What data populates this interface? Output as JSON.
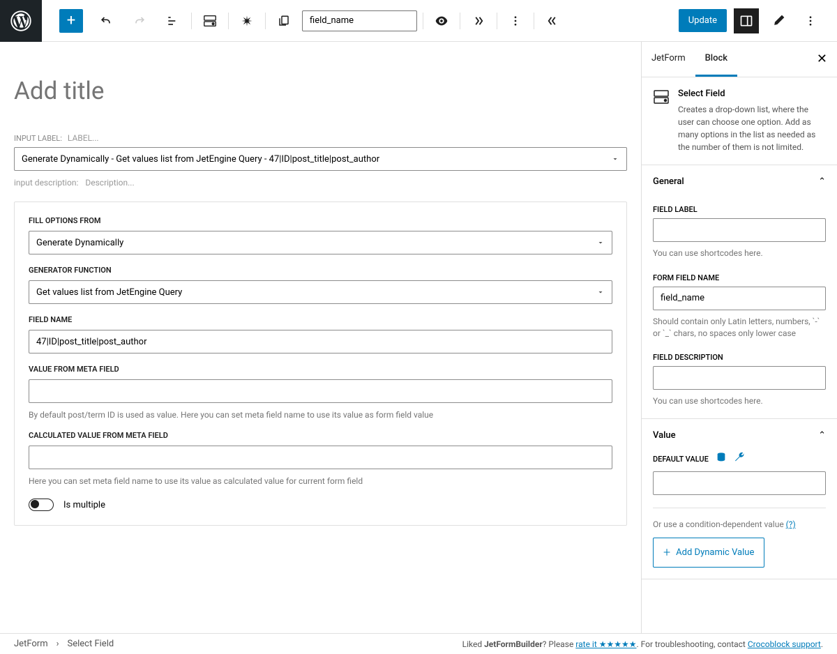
{
  "toolbar": {
    "field_name_value": "field_name",
    "update_label": "Update"
  },
  "editor": {
    "title_placeholder": "Add title",
    "input_label_prefix": "INPUT LABEL:",
    "input_label_placeholder": "LABEL...",
    "select_display": "Generate Dynamically - Get values list from JetEngine Query - 47|ID|post_title|post_author",
    "desc_prefix": "input description:",
    "desc_placeholder": "Description..."
  },
  "options": {
    "fill_label": "Fill Options From",
    "fill_value": "Generate Dynamically",
    "gen_func_label": "Generator Function",
    "gen_func_value": "Get values list from JetEngine Query",
    "field_name_label": "Field Name",
    "field_name_value": "47|ID|post_title|post_author",
    "value_meta_label": "Value from meta field",
    "value_meta_help": "By default post/term ID is used as value. Here you can set meta field name to use its value as form field value",
    "calc_label": "Calculated value from meta field",
    "calc_help": "Here you can set meta field name to use its value as calculated value for current form field",
    "is_multiple": "Is multiple"
  },
  "sidebar": {
    "tabs": {
      "jetform": "JetForm",
      "block": "Block"
    },
    "block_title": "Select Field",
    "block_desc": "Creates a drop-down list, where the user can choose one option. Add as many options in the list as needed as the number of them is not limited.",
    "general": {
      "title": "General",
      "field_label": "Field Label",
      "shortcodes_hint": "You can use shortcodes here.",
      "form_field_name": "Form field name",
      "form_field_name_value": "field_name",
      "form_field_name_hint": "Should contain only Latin letters, numbers, `-` or `_` chars, no spaces only lower case",
      "field_description": "Field Description"
    },
    "value": {
      "title": "Value",
      "default_label": "Default Value",
      "cond_text": "Or use a condition-dependent value ",
      "cond_link": "(?)",
      "add_dynamic": "Add Dynamic Value"
    }
  },
  "footer": {
    "crumb1": "JetForm",
    "crumb2": "Select Field",
    "liked": "Liked ",
    "product": "JetFormBuilder",
    "please": "? Please ",
    "rate": "rate it ★★★★★",
    "troubleshoot": ". For troubleshooting, contact ",
    "support": "Crocoblock support",
    "dot": "."
  }
}
